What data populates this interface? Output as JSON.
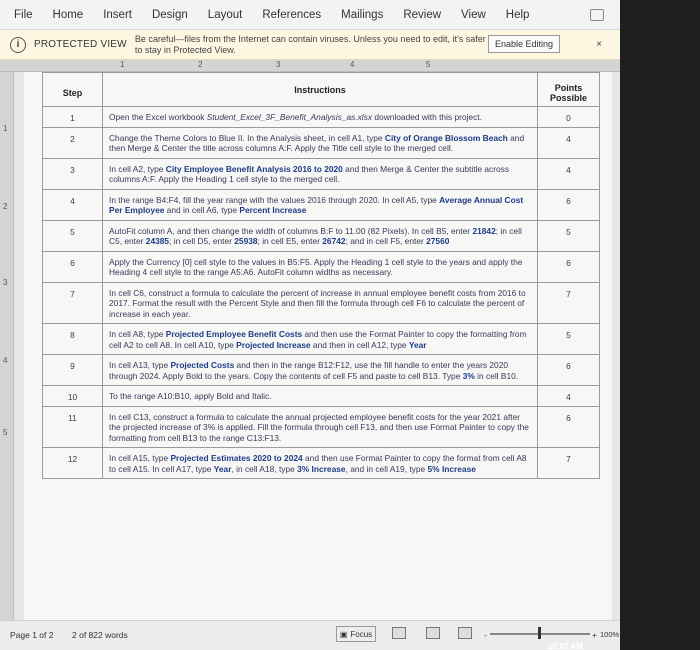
{
  "menu": [
    "File",
    "Home",
    "Insert",
    "Design",
    "Layout",
    "References",
    "Mailings",
    "Review",
    "View",
    "Help"
  ],
  "protected_view": {
    "label": "PROTECTED VIEW",
    "message": "Be careful—files from the Internet can contain viruses. Unless you need to edit, it's safer to stay in Protected View.",
    "button": "Enable Editing",
    "close": "×"
  },
  "ruler_ticks": [
    "1",
    "2",
    "3",
    "4",
    "5"
  ],
  "table": {
    "headers": {
      "step": "Step",
      "instructions": "Instructions",
      "points": "Points Possible"
    },
    "rows": [
      {
        "step": "1",
        "points": "0",
        "parts": [
          {
            "t": "Open the Excel workbook "
          },
          {
            "t": "Student_Excel_3F_Benefit_Analysis_as.xlsx",
            "i": true
          },
          {
            "t": " downloaded with this project."
          }
        ]
      },
      {
        "step": "2",
        "points": "4",
        "parts": [
          {
            "t": "Change the Theme Colors to Blue II. In the Analysis sheet, in cell A1, type "
          },
          {
            "t": "City of Orange Blossom Beach",
            "b": true
          },
          {
            "t": " and then Merge & Center the title across columns A:F. Apply the Title cell style to the merged cell."
          }
        ]
      },
      {
        "step": "3",
        "points": "4",
        "parts": [
          {
            "t": "In cell A2, type "
          },
          {
            "t": "City Employee Benefit Analysis 2016 to 2020",
            "b": true
          },
          {
            "t": " and then Merge & Center the subtitle across columns A:F. Apply the Heading 1 cell style to the merged cell."
          }
        ]
      },
      {
        "step": "4",
        "points": "6",
        "parts": [
          {
            "t": "In the range B4:F4, fill the year range with the values 2016 through 2020. In cell A5, type "
          },
          {
            "t": "Average Annual Cost Per Employee",
            "b": true
          },
          {
            "t": " and in cell A6, type "
          },
          {
            "t": "Percent Increase",
            "b": true
          }
        ]
      },
      {
        "step": "5",
        "points": "5",
        "parts": [
          {
            "t": "AutoFit column A, and then change the width of columns B:F to 11.00 (82 Pixels). In cell B5, enter "
          },
          {
            "t": "21842",
            "b": true
          },
          {
            "t": "; in cell C5, enter "
          },
          {
            "t": "24385",
            "b": true
          },
          {
            "t": "; in cell D5, enter "
          },
          {
            "t": "25938",
            "b": true
          },
          {
            "t": "; in cell E5, enter "
          },
          {
            "t": "26742",
            "b": true
          },
          {
            "t": "; and in cell F5, enter "
          },
          {
            "t": "27560",
            "b": true
          }
        ]
      },
      {
        "step": "6",
        "points": "6",
        "parts": [
          {
            "t": "Apply the Currency [0] cell style to the values in B5:F5. Apply the Heading 1 cell style to the years and apply the Heading 4 cell style to the range A5:A6. AutoFit column widths as necessary."
          }
        ]
      },
      {
        "step": "7",
        "points": "7",
        "parts": [
          {
            "t": "In cell C6, construct a formula to calculate the percent of increase in annual employee benefit costs from 2016 to 2017. Format the result with the Percent Style and then fill the formula through cell F6 to calculate the percent of increase in each year."
          }
        ]
      },
      {
        "step": "8",
        "points": "5",
        "parts": [
          {
            "t": "In cell A8, type "
          },
          {
            "t": "Projected Employee Benefit Costs",
            "b": true
          },
          {
            "t": " and then use the Format Painter to copy the formatting from cell A2 to cell A8. In cell A10, type "
          },
          {
            "t": "Projected Increase",
            "b": true
          },
          {
            "t": " and then in cell A12, type "
          },
          {
            "t": "Year",
            "b": true
          }
        ]
      },
      {
        "step": "9",
        "points": "6",
        "parts": [
          {
            "t": "In cell A13, type "
          },
          {
            "t": "Projected Costs",
            "b": true
          },
          {
            "t": " and then in the range B12:F12, use the fill handle to enter the years 2020 through 2024. Apply Bold to the years. Copy the contents of cell F5 and paste to cell B13. Type "
          },
          {
            "t": "3%",
            "b": true
          },
          {
            "t": " in cell B10."
          }
        ]
      },
      {
        "step": "10",
        "points": "4",
        "parts": [
          {
            "t": "To the range A10:B10, apply Bold and Italic."
          }
        ]
      },
      {
        "step": "11",
        "points": "6",
        "parts": [
          {
            "t": "In cell C13, construct a formula to calculate the annual projected employee benefit costs for the year 2021 after the projected increase of 3% is applied. Fill the formula through cell F13, and then use Format Painter to copy the formatting from cell B13 to the range C13:F13."
          }
        ]
      },
      {
        "step": "12",
        "points": "7",
        "parts": [
          {
            "t": "In cell A15, type "
          },
          {
            "t": "Projected Estimates 2020 to 2024",
            "b": true
          },
          {
            "t": " and then use Format Painter to copy the format from cell A8 to cell A15. In cell A17, type "
          },
          {
            "t": "Year",
            "b": true
          },
          {
            "t": ", in cell A18, type "
          },
          {
            "t": "3% Increase",
            "b": true
          },
          {
            "t": ", and in cell A19, type "
          },
          {
            "t": "5% Increase",
            "b": true
          }
        ]
      }
    ]
  },
  "status": {
    "page": "Page 1 of 2",
    "words": "2 of 822 words",
    "focus": "Focus",
    "zoom_minus": "-",
    "zoom_plus": "+",
    "zoom": "100%",
    "zoom_level": 0.5,
    "time": "10:07 AM"
  },
  "colors": {
    "highlight_text": "#1f3c88",
    "protected_bar": "#fdf6e0"
  }
}
